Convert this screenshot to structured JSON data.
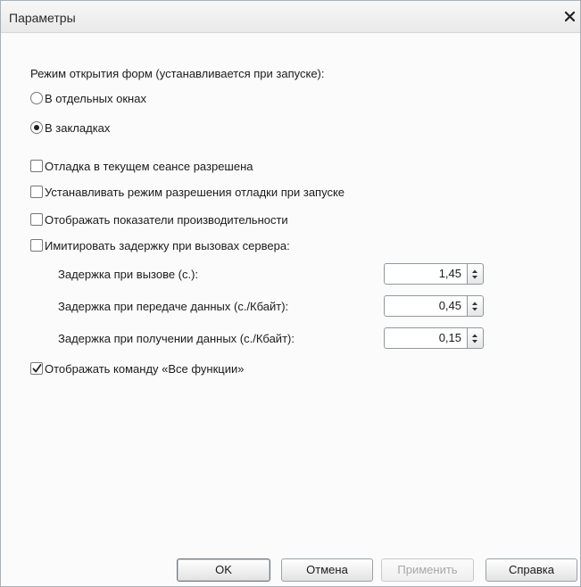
{
  "window": {
    "title": "Параметры",
    "close_label": "✕"
  },
  "form_mode": {
    "heading": "Режим открытия форм (устанавливается при запуске):",
    "options": [
      {
        "label": "В отдельных окнах",
        "selected": false
      },
      {
        "label": "В закладках",
        "selected": true
      }
    ]
  },
  "debug": {
    "allowed_label": "Отладка в текущем сеансе разрешена",
    "allowed_checked": false,
    "set_mode_label": "Устанавливать режим разрешения отладки при запуске",
    "set_mode_checked": false,
    "perf_label": "Отображать показатели производительности",
    "perf_checked": false,
    "simulate_label": "Имитировать задержку при вызовах сервера:",
    "simulate_checked": false
  },
  "delays": [
    {
      "label": "Задержка при вызове (с.):",
      "value": "1,45"
    },
    {
      "label": "Задержка при передаче данных (с./Кбайт):",
      "value": "0,45"
    },
    {
      "label": "Задержка при получении данных (с./Кбайт):",
      "value": "0,15"
    }
  ],
  "all_functions": {
    "label": "Отображать команду «Все функции»",
    "checked": true
  },
  "buttons": {
    "ok": "OK",
    "cancel": "Отмена",
    "apply": "Применить",
    "help": "Справка"
  }
}
